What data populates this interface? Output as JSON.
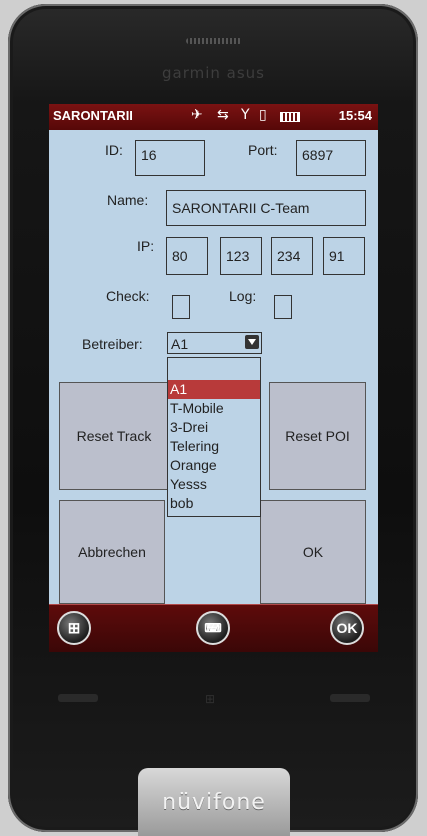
{
  "device": {
    "brand": "garmin asus",
    "footer_logo": "nüvifone"
  },
  "status_bar": {
    "carrier": "SARONTARII",
    "time": "15:54",
    "icons": [
      "gps-icon",
      "sync-icon",
      "signal-icon",
      "vibrate-icon",
      "battery-icon"
    ]
  },
  "form": {
    "id_label": "ID:",
    "id_value": "16",
    "port_label": "Port:",
    "port_value": "6897",
    "name_label": "Name:",
    "name_value": "SARONTARII C-Team",
    "ip_label": "IP:",
    "ip": [
      "80",
      "123",
      "234",
      "91"
    ],
    "check_label": "Check:",
    "log_label": "Log:",
    "operator_label": "Betreiber:",
    "operator_value": "A1",
    "operator_options": [
      "A1",
      "T-Mobile",
      "3-Drei",
      "Telering",
      "Orange",
      "Yesss",
      "bob"
    ],
    "selected_option_index": 0
  },
  "buttons": {
    "reset_track": "Reset Track",
    "reset_poi": "Reset POI",
    "cancel": "Abbrechen",
    "ok": "OK"
  },
  "softbar": {
    "ok": "OK"
  },
  "colors": {
    "screen_bg": "#bcd3e6",
    "status_bar": "#6a0e0e",
    "selection": "#b83a3a"
  }
}
